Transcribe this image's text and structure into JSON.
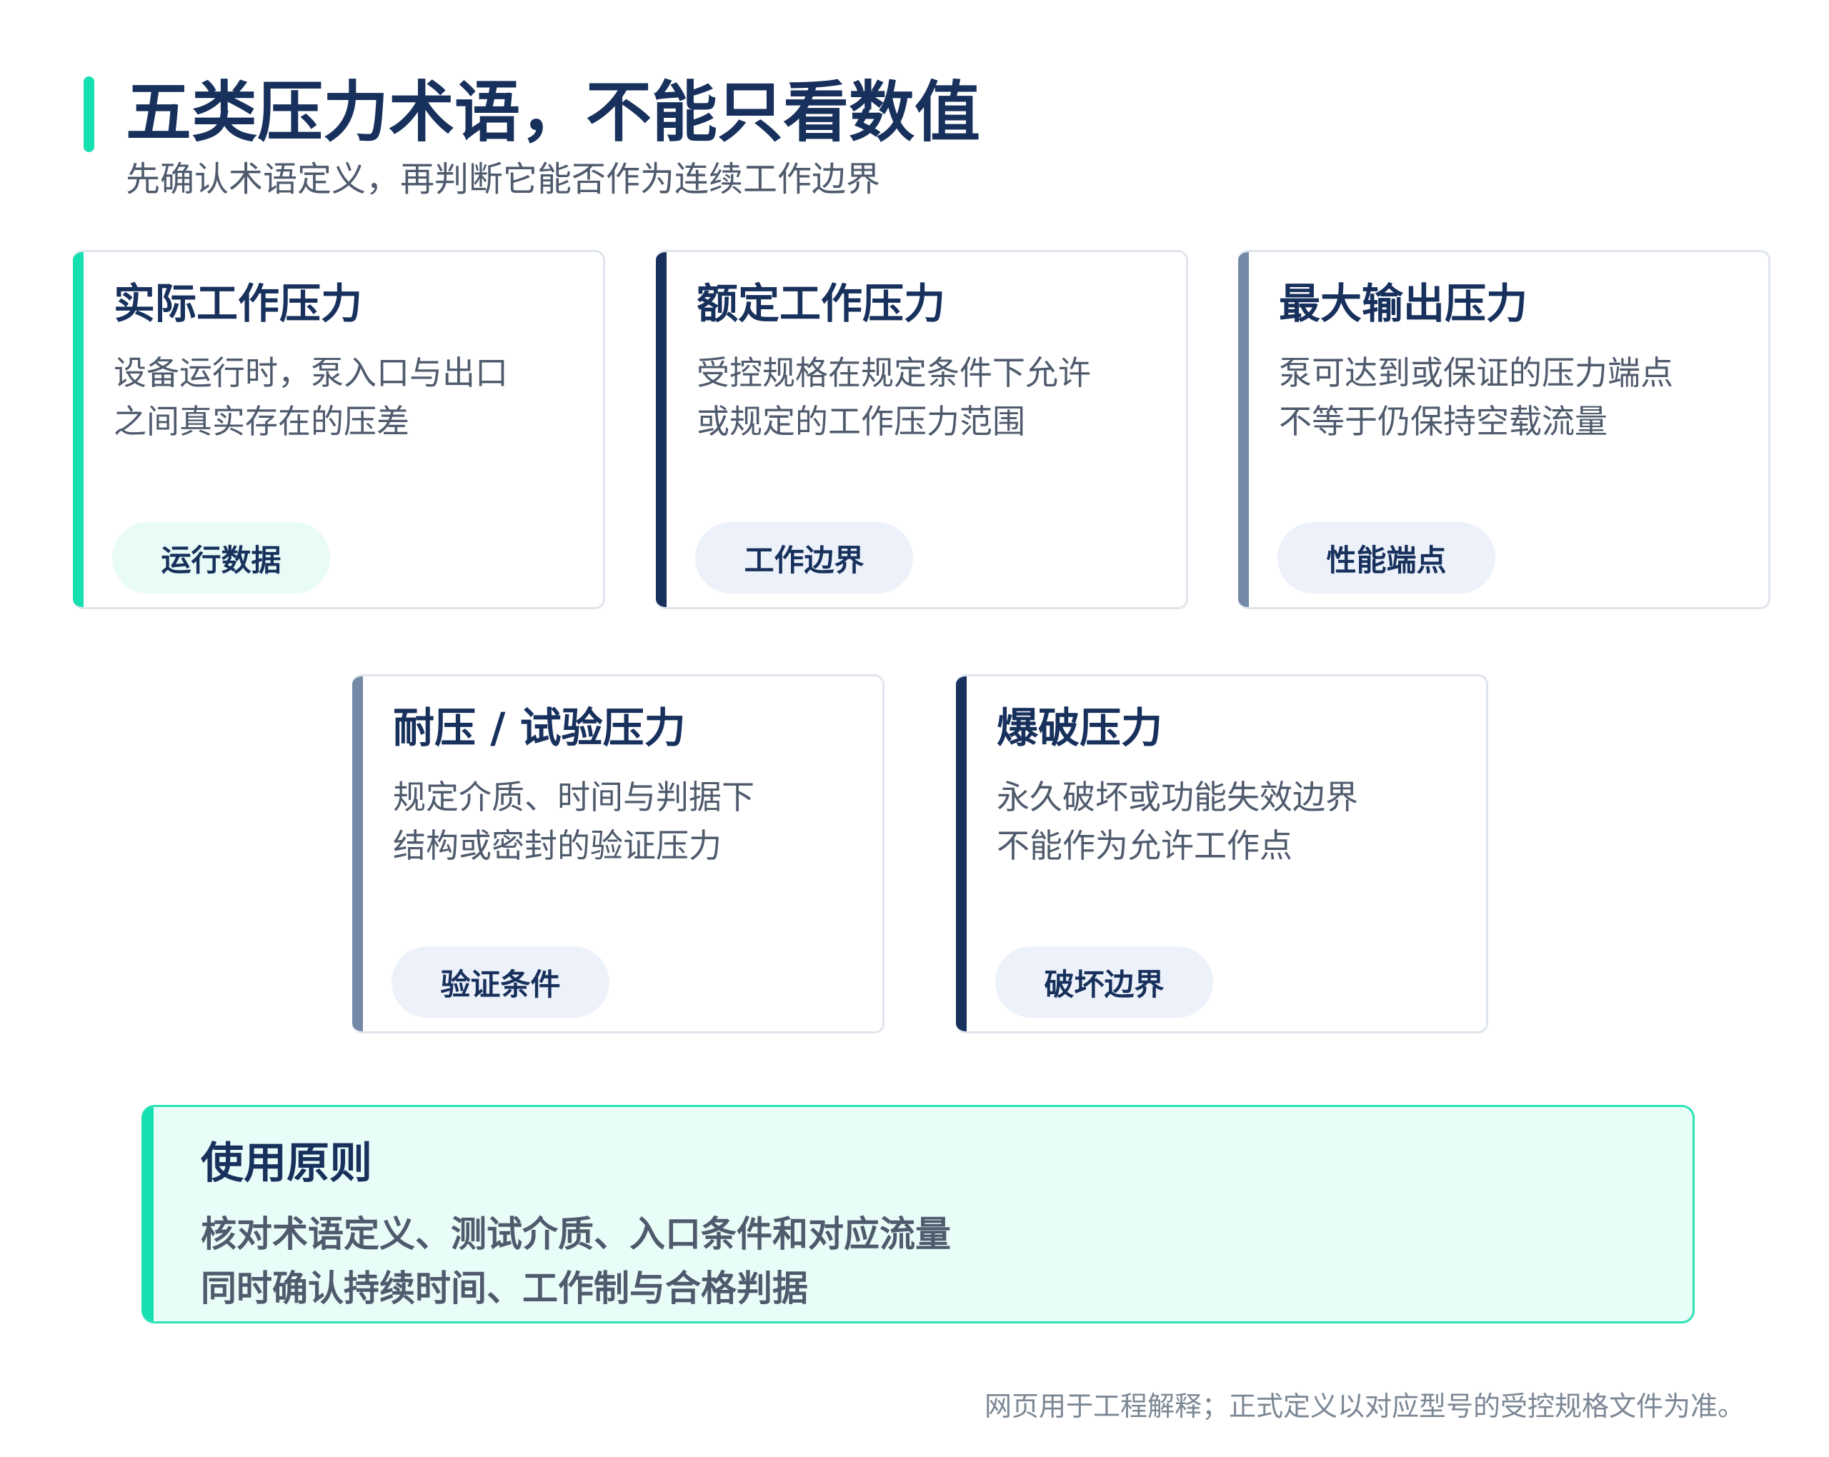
{
  "header": {
    "title": "五类压力术语，不能只看数值",
    "subtitle": "先确认术语定义，再判断它能否作为连续工作边界"
  },
  "cards": [
    {
      "title": "实际工作压力",
      "lines": [
        "设备运行时，泵入口与出口",
        "之间真实存在的压差"
      ],
      "tag": "运行数据"
    },
    {
      "title": "额定工作压力",
      "lines": [
        "受控规格在规定条件下允许",
        "或规定的工作压力范围"
      ],
      "tag": "工作边界"
    },
    {
      "title": "最大输出压力",
      "lines": [
        "泵可达到或保证的压力端点",
        "不等于仍保持空载流量"
      ],
      "tag": "性能端点"
    },
    {
      "title": "耐压 / 试验压力",
      "lines": [
        "规定介质、时间与判据下",
        "结构或密封的验证压力"
      ],
      "tag": "验证条件"
    },
    {
      "title": "爆破压力",
      "lines": [
        "永久破坏或功能失效边界",
        "不能作为允许工作点"
      ],
      "tag": "破坏边界"
    }
  ],
  "principle": {
    "title": "使用原则",
    "lines": [
      "核对术语定义、测试介质、入口条件和对应流量",
      "同时确认持续时间、工作制与合格判据"
    ]
  },
  "footnote": "网页用于工程解释；正式定义以对应型号的受控规格文件为准。",
  "colors": {
    "mint_accent": "#16e0b0",
    "navy_accent": "#17305c",
    "slate_accent": "#7489a7",
    "mint_fill": "#e8fdf8",
    "tag_blue_fill": "#edf2fa"
  }
}
